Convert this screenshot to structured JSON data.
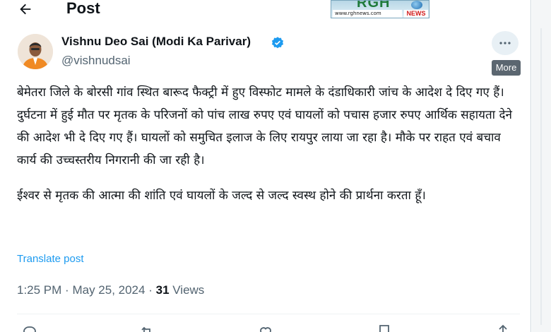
{
  "header": {
    "title": "Post",
    "back_icon": "arrow-left-icon"
  },
  "watermark": {
    "logo_text": "RGH",
    "url": "www.rghnews.com",
    "news_label": "NEWS"
  },
  "author": {
    "name": "Vishnu Deo Sai (Modi Ka Parivar)",
    "handle": "@vishnudsai",
    "verified_icon": "verified-badge-icon",
    "accent_color": "#1d9bf0"
  },
  "more": {
    "icon": "more-dots-icon",
    "tooltip": "More"
  },
  "post": {
    "paragraph_1": "बेमेतरा जिले के बोरसी गांव स्थित बारूद फैक्ट्री में हुए विस्फोट मामले के दंडाधिकारी जांच के आदेश दे दिए गए हैं। दुर्घटना में हुई मौत पर मृतक के परिजनों को पांच लाख रुपए एवं घायलों को पचास हजार रुपए आर्थिक सहायता देने की आदेश भी दे दिए गए हैं। घायलों को समुचित इलाज के लिए रायपुर लाया जा रहा है। मौके पर राहत एवं बचाव कार्य की उच्चस्तरीय निगरानी की जा रही है।",
    "paragraph_2": "ईश्वर से मृतक की आत्मा की शांति एवं घायलों के जल्द से जल्द स्वस्थ होने की प्रार्थना करता हूँ।",
    "translate_label": "Translate post"
  },
  "meta": {
    "time": "1:25 PM",
    "separator": "·",
    "date": "May 25, 2024",
    "views_count": "31",
    "views_label": "Views"
  },
  "actions": {
    "reply_icon": "reply-icon",
    "repost_icon": "repost-icon",
    "like_icon": "like-icon",
    "bookmark_icon": "bookmark-icon",
    "share_icon": "share-icon"
  }
}
